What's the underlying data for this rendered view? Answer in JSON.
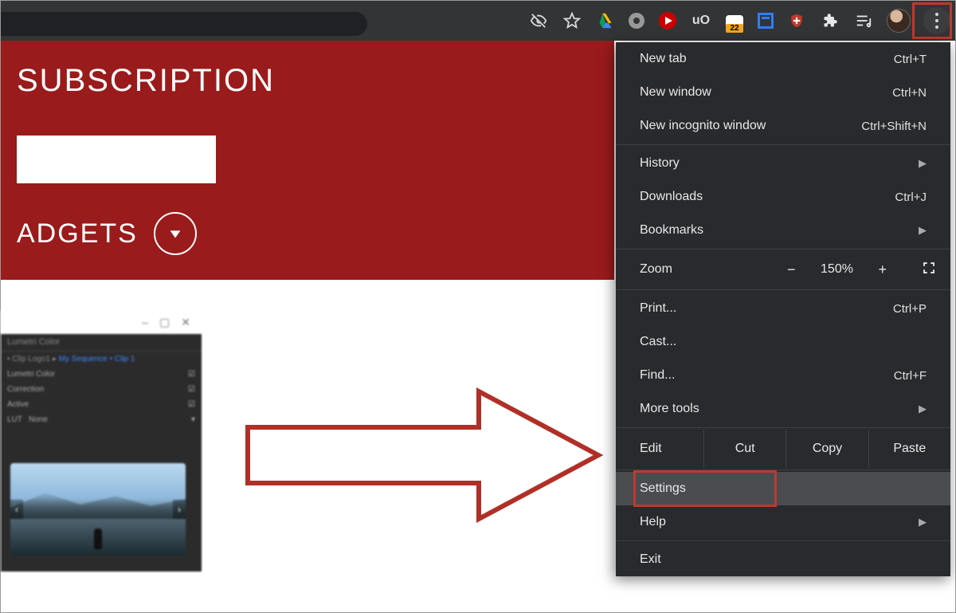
{
  "toolbar": {
    "extensions": {
      "honey_badge": "22"
    }
  },
  "page": {
    "title": "SUBSCRIPTION",
    "nav_item": "ADGETS"
  },
  "menu": {
    "new_tab": {
      "label": "New tab",
      "shortcut": "Ctrl+T"
    },
    "new_window": {
      "label": "New window",
      "shortcut": "Ctrl+N"
    },
    "incognito": {
      "label": "New incognito window",
      "shortcut": "Ctrl+Shift+N"
    },
    "history": {
      "label": "History"
    },
    "downloads": {
      "label": "Downloads",
      "shortcut": "Ctrl+J"
    },
    "bookmarks": {
      "label": "Bookmarks"
    },
    "zoom": {
      "label": "Zoom",
      "value": "150%"
    },
    "print": {
      "label": "Print...",
      "shortcut": "Ctrl+P"
    },
    "cast": {
      "label": "Cast..."
    },
    "find": {
      "label": "Find...",
      "shortcut": "Ctrl+F"
    },
    "more_tools": {
      "label": "More tools"
    },
    "edit": {
      "label": "Edit",
      "cut": "Cut",
      "copy": "Copy",
      "paste": "Paste"
    },
    "settings": {
      "label": "Settings"
    },
    "help": {
      "label": "Help"
    },
    "exit": {
      "label": "Exit"
    }
  }
}
